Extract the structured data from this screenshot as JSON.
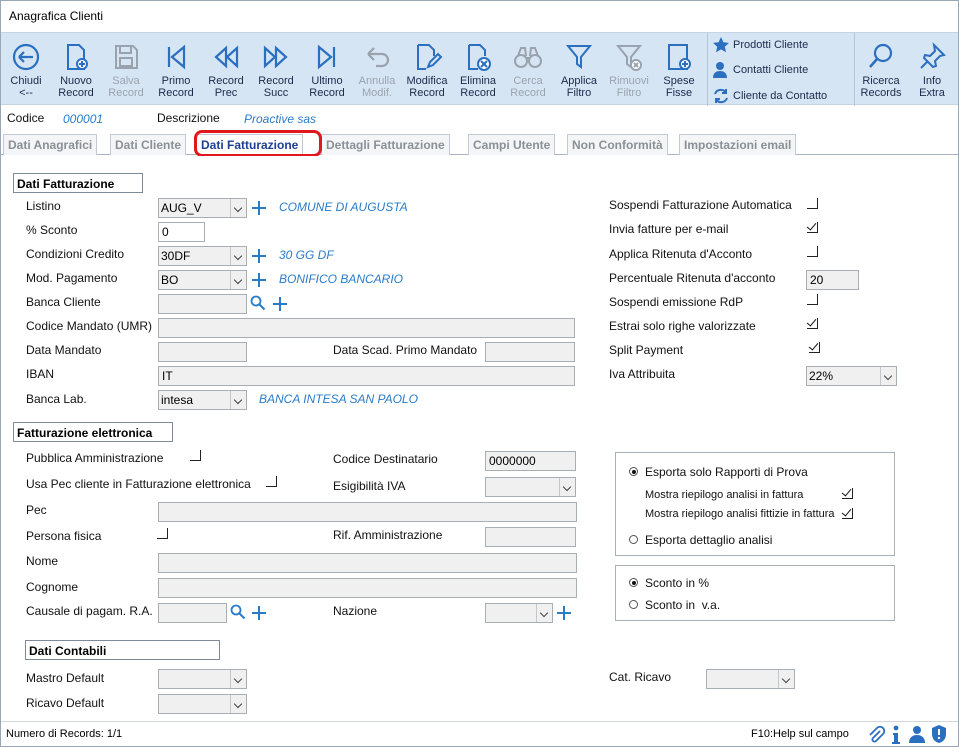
{
  "window": {
    "title": "Anagrafica Clienti"
  },
  "toolbar": {
    "buttons": [
      {
        "label": "Chiudi",
        "label2": "<--",
        "icon": "back-circle-icon"
      },
      {
        "label": "Nuovo",
        "label2": "Record",
        "icon": "new-doc-icon"
      },
      {
        "label": "Salva",
        "label2": "Record",
        "icon": "save-icon"
      },
      {
        "label": "Primo",
        "label2": "Record",
        "icon": "first-icon"
      },
      {
        "label": "Record",
        "label2": "Prec",
        "icon": "prev-icon"
      },
      {
        "label": "Record",
        "label2": "Succ",
        "icon": "next-icon"
      },
      {
        "label": "Ultimo",
        "label2": "Record",
        "icon": "last-icon"
      },
      {
        "label": "Annulla",
        "label2": "Modif.",
        "icon": "undo-icon"
      },
      {
        "label": "Modifica",
        "label2": "Record",
        "icon": "edit-icon"
      },
      {
        "label": "Elimina",
        "label2": "Record",
        "icon": "delete-doc-icon"
      },
      {
        "label": "Cerca",
        "label2": "Record",
        "icon": "binoculars-icon"
      },
      {
        "label": "Applica",
        "label2": "Filtro",
        "icon": "filter-icon"
      },
      {
        "label": "Rimuovi",
        "label2": "Filtro",
        "icon": "remove-filter-icon"
      },
      {
        "label": "Spese",
        "label2": "Fisse",
        "icon": "expense-icon"
      }
    ],
    "side": {
      "prodotti": "Prodotti Cliente",
      "contatti": "Contatti Cliente",
      "cliente_contatto": "Cliente da Contatto"
    },
    "ricerca": {
      "label": "Ricerca",
      "label2": "Records"
    },
    "info": {
      "label": "Info",
      "label2": "Extra"
    }
  },
  "record": {
    "codice_label": "Codice",
    "codice_value": "000001",
    "descrizione_label": "Descrizione",
    "descrizione_value": "Proactive sas"
  },
  "tabs": [
    "Dati Anagrafici",
    "Dati Cliente",
    "Dati Fatturazione",
    "Dettagli Fatturazione",
    "Campi Utente",
    "Non Conformità",
    "Impostazioni email"
  ],
  "fatturazione": {
    "section_title": "Dati Fatturazione",
    "listino_label": "Listino",
    "listino_value": "AUG_V",
    "listino_desc": "COMUNE DI AUGUSTA",
    "sconto_label": "% Sconto",
    "sconto_value": "0",
    "cond_credito_label": "Condizioni Credito",
    "cond_credito_value": "30DF",
    "cond_credito_desc": "30 GG DF",
    "mod_pagamento_label": "Mod. Pagamento",
    "mod_pagamento_value": "BO",
    "mod_pagamento_desc": "BONIFICO BANCARIO",
    "banca_cliente_label": "Banca Cliente",
    "banca_cliente_value": "",
    "codice_mandato_label": "Codice Mandato (UMR)",
    "codice_mandato_value": "",
    "data_mandato_label": "Data Mandato",
    "data_mandato_value": "",
    "data_scad_label": "Data Scad. Primo Mandato",
    "data_scad_value": "",
    "iban_label": "IBAN",
    "iban_value": "IT",
    "banca_lab_label": "Banca Lab.",
    "banca_lab_value": "intesa",
    "banca_lab_desc": "BANCA INTESA SAN PAOLO"
  },
  "right_options": {
    "sospendi_auto": "Sospendi Fatturazione Automatica",
    "invia_email": "Invia fatture per e-mail",
    "ritenuta": "Applica Ritenuta d'Acconto",
    "perc_ritenuta_label": "Percentuale Ritenuta d'acconto",
    "perc_ritenuta_value": "20",
    "sospendi_rdp": "Sospendi emissione RdP",
    "estrai_righe": "Estrai solo righe valorizzate",
    "split_payment": "Split Payment",
    "iva_label": "Iva Attribuita",
    "iva_value": "22%"
  },
  "elettronica": {
    "section_title": "Fatturazione elettronica",
    "pa_label": "Pubblica Amministrazione",
    "codice_dest_label": "Codice Destinatario",
    "codice_dest_value": "0000000",
    "usa_pec_label": "Usa Pec cliente in Fatturazione elettronica",
    "esigibilita_label": "Esigibilità IVA",
    "esigibilita_value": "",
    "pec_label": "Pec",
    "pec_value": "",
    "persona_label": "Persona fisica",
    "rif_amm_label": "Rif. Amministrazione",
    "rif_amm_value": "",
    "nome_label": "Nome",
    "nome_value": "",
    "cognome_label": "Cognome",
    "cognome_value": "",
    "causale_label": "Causale di pagam. R.A.",
    "causale_value": "",
    "nazione_label": "Nazione",
    "nazione_value": ""
  },
  "export_group": {
    "solo_rapporti": "Esporta solo Rapporti di Prova",
    "mostra_riepilogo": "Mostra riepilogo analisi in fattura",
    "mostra_fittizie": "Mostra riepilogo analisi fittizie in fattura",
    "dettaglio": "Esporta dettaglio analisi"
  },
  "sconto_group": {
    "percent": "Sconto in %",
    "va": "Sconto in  v.a."
  },
  "contabili": {
    "section_title": "Dati Contabili",
    "mastro_label": "Mastro Default",
    "mastro_value": "",
    "ricavo_label": "Ricavo Default",
    "ricavo_value": "",
    "cat_ricavo_label": "Cat. Ricavo",
    "cat_ricavo_value": ""
  },
  "status": {
    "records": "Numero di Records: 1/1",
    "help": "F10:Help sul campo"
  }
}
